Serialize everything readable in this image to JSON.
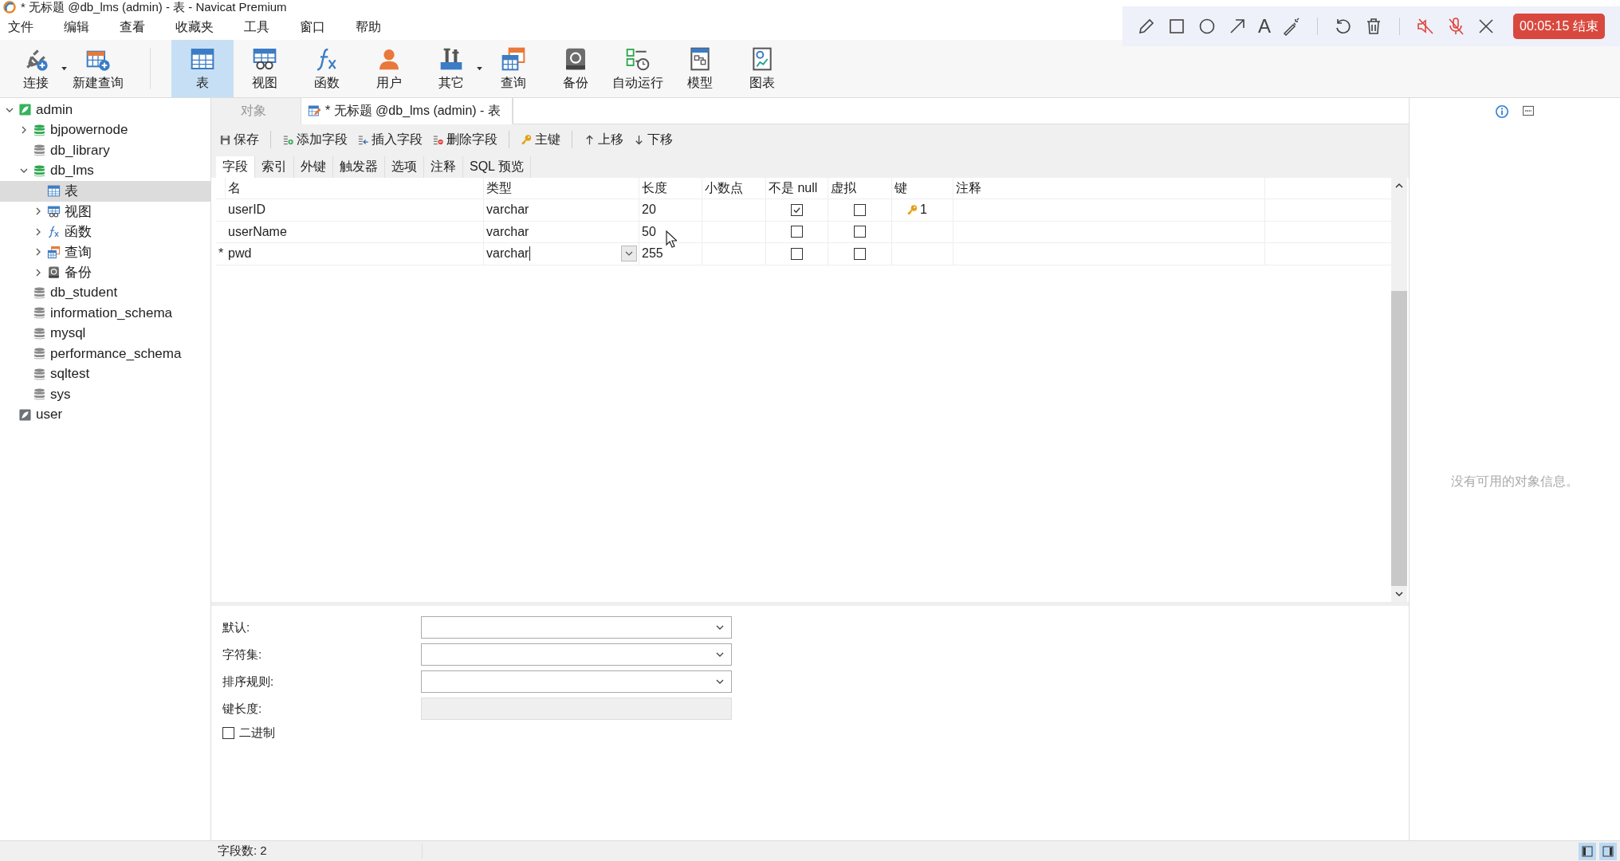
{
  "window": {
    "title": "* 无标题 @db_lms (admin) - 表 - Navicat Premium"
  },
  "menu": [
    "文件",
    "编辑",
    "查看",
    "收藏夹",
    "工具",
    "窗口",
    "帮助"
  ],
  "recorder": {
    "text_tool": "A",
    "speaker_muted": true,
    "mic_muted": true,
    "timer": "00:05:15 结束"
  },
  "toolbar": [
    {
      "label": "连接",
      "kind": "connect",
      "dropdown": true,
      "selected": false
    },
    {
      "label": "新建查询",
      "kind": "newquery",
      "dropdown": false,
      "selected": false
    },
    {
      "label": "表",
      "kind": "table",
      "dropdown": false,
      "selected": true
    },
    {
      "label": "视图",
      "kind": "view",
      "dropdown": false,
      "selected": false
    },
    {
      "label": "函数",
      "kind": "function",
      "dropdown": false,
      "selected": false
    },
    {
      "label": "用户",
      "kind": "user",
      "dropdown": false,
      "selected": false
    },
    {
      "label": "其它",
      "kind": "other",
      "dropdown": true,
      "selected": false
    },
    {
      "label": "查询",
      "kind": "query",
      "dropdown": false,
      "selected": false
    },
    {
      "label": "备份",
      "kind": "backup",
      "dropdown": false,
      "selected": false
    },
    {
      "label": "自动运行",
      "kind": "autorun",
      "dropdown": false,
      "selected": false
    },
    {
      "label": "模型",
      "kind": "model",
      "dropdown": false,
      "selected": false
    },
    {
      "label": "图表",
      "kind": "chart",
      "dropdown": false,
      "selected": false
    }
  ],
  "sidebar": {
    "tree": [
      {
        "label": "admin",
        "kind": "connection",
        "connected": true,
        "expanded": true,
        "selected": false,
        "children": [
          {
            "label": "bjpowernode",
            "kind": "database",
            "connected": true,
            "expanded": false,
            "selected": false
          },
          {
            "label": "db_library",
            "kind": "database",
            "connected": false,
            "selected": false
          },
          {
            "label": "db_lms",
            "kind": "database",
            "connected": true,
            "expanded": true,
            "selected": false,
            "children": [
              {
                "label": "表",
                "kind": "table",
                "selected": true
              },
              {
                "label": "视图",
                "kind": "view",
                "expanded": false,
                "selected": false
              },
              {
                "label": "函数",
                "kind": "function",
                "expanded": false,
                "selected": false
              },
              {
                "label": "查询",
                "kind": "query",
                "expanded": false,
                "selected": false
              },
              {
                "label": "备份",
                "kind": "backup",
                "expanded": false,
                "selected": false
              }
            ]
          },
          {
            "label": "db_student",
            "kind": "database",
            "connected": false,
            "selected": false
          },
          {
            "label": "information_schema",
            "kind": "database",
            "connected": false,
            "selected": false
          },
          {
            "label": "mysql",
            "kind": "database",
            "connected": false,
            "selected": false
          },
          {
            "label": "performance_schema",
            "kind": "database",
            "connected": false,
            "selected": false
          },
          {
            "label": "sqltest",
            "kind": "database",
            "connected": false,
            "selected": false
          },
          {
            "label": "sys",
            "kind": "database",
            "connected": false,
            "selected": false
          }
        ]
      },
      {
        "label": "user",
        "kind": "connection",
        "connected": false,
        "selected": false
      }
    ]
  },
  "tabs": [
    {
      "label": "对象",
      "kind": "object",
      "selected": false
    },
    {
      "label": "* 无标题 @db_lms (admin) - 表",
      "kind": "design",
      "selected": true
    }
  ],
  "edit_toolbar": [
    {
      "label": "保存",
      "kind": "save"
    },
    {
      "label": "添加字段",
      "kind": "add"
    },
    {
      "label": "插入字段",
      "kind": "insert"
    },
    {
      "label": "删除字段",
      "kind": "delete"
    },
    {
      "label": "主键",
      "kind": "key"
    },
    {
      "label": "上移",
      "kind": "up"
    },
    {
      "label": "下移",
      "kind": "down"
    }
  ],
  "subtabs": [
    {
      "label": "字段",
      "selected": true
    },
    {
      "label": "索引",
      "selected": false
    },
    {
      "label": "外键",
      "selected": false
    },
    {
      "label": "触发器",
      "selected": false
    },
    {
      "label": "选项",
      "selected": false
    },
    {
      "label": "注释",
      "selected": false
    },
    {
      "label": "SQL 预览",
      "selected": false
    }
  ],
  "table": {
    "columns": [
      "名",
      "类型",
      "长度",
      "小数点",
      "不是 null",
      "虚拟",
      "键",
      "注释"
    ],
    "rows": [
      {
        "name": "userID",
        "type": "varchar",
        "editing": false,
        "length": "20",
        "not_null": true,
        "virtual": false,
        "key": "1"
      },
      {
        "name": "userName",
        "type": "varchar",
        "editing": false,
        "length": "50",
        "not_null": false,
        "virtual": false
      },
      {
        "marker": "*",
        "name": "pwd",
        "type": "varchar",
        "editing": true,
        "length": "255",
        "not_null": false,
        "virtual": false
      }
    ]
  },
  "properties": [
    {
      "label": "默认:",
      "kind": "select"
    },
    {
      "label": "字符集:",
      "kind": "select"
    },
    {
      "label": "排序规则:",
      "kind": "select"
    },
    {
      "label": "键长度:",
      "kind": "readonly"
    }
  ],
  "binary": {
    "label": "二进制",
    "checked": false
  },
  "info_panel": {
    "message": "没有可用的对象信息。"
  },
  "status_bar": {
    "field_count": "字段数: 2"
  }
}
